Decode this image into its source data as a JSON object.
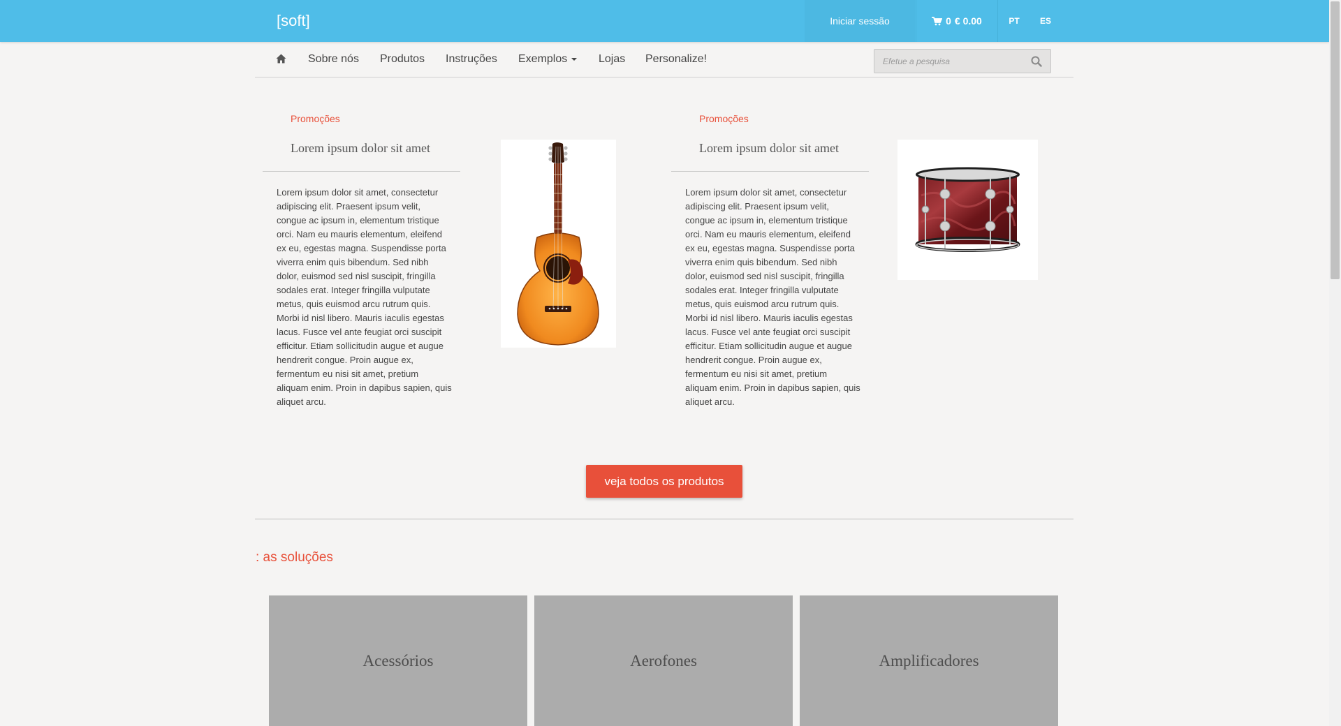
{
  "header": {
    "brand": "[soft]",
    "login_label": "Iniciar sessão",
    "cart_count": "0",
    "cart_total": "€ 0.00",
    "languages": [
      "PT",
      "ES"
    ],
    "bar_color": "#4fbde8"
  },
  "nav": {
    "home_icon": "home-icon",
    "items": [
      {
        "label": "Sobre nós"
      },
      {
        "label": "Produtos"
      },
      {
        "label": "Instruções"
      },
      {
        "label": "Exemplos",
        "has_dropdown": true
      },
      {
        "label": "Lojas"
      },
      {
        "label": "Personalize!"
      }
    ],
    "search_placeholder": "Efetue a pesquisa",
    "search_icon": "search-icon"
  },
  "promos": [
    {
      "tag": "Promoções",
      "title": "Lorem ipsum dolor sit amet",
      "text": "Lorem ipsum dolor sit amet, consectetur adipiscing elit. Praesent ipsum velit, congue ac ipsum in, elementum tristique orci. Nam eu mauris elementum, eleifend ex eu, egestas magna. Suspendisse porta viverra enim quis bibendum. Sed nibh dolor, euismod sed nisl suscipit, fringilla sodales erat. Integer fringilla vulputate metus, quis euismod arcu rutrum quis. Morbi id nisl libero. Mauris iaculis egestas lacus. Fusce vel ante feugiat orci suscipit efficitur. Etiam sollicitudin augue et augue hendrerit congue. Proin augue ex, fermentum eu nisi sit amet, pretium aliquam enim. Proin in dapibus sapien, quis aliquet arcu.",
      "image": "acoustic-guitar"
    },
    {
      "tag": "Promoções",
      "title": "Lorem ipsum dolor sit amet",
      "text": "Lorem ipsum dolor sit amet, consectetur adipiscing elit. Praesent ipsum velit, congue ac ipsum in, elementum tristique orci. Nam eu mauris elementum, eleifend ex eu, egestas magna. Suspendisse porta viverra enim quis bibendum. Sed nibh dolor, euismod sed nisl suscipit, fringilla sodales erat. Integer fringilla vulputate metus, quis euismod arcu rutrum quis. Morbi id nisl libero. Mauris iaculis egestas lacus. Fusce vel ante feugiat orci suscipit efficitur. Etiam sollicitudin augue et augue hendrerit congue. Proin augue ex, fermentum eu nisi sit amet, pretium aliquam enim. Proin in dapibus sapien, quis aliquet arcu.",
      "image": "tom-drum"
    }
  ],
  "cta": {
    "label": "veja todos os produtos",
    "color": "#e8503a"
  },
  "solutions": {
    "title": ": as soluções",
    "categories": [
      {
        "label": "Acessórios"
      },
      {
        "label": "Aerofones"
      },
      {
        "label": "Amplificadores"
      }
    ]
  }
}
